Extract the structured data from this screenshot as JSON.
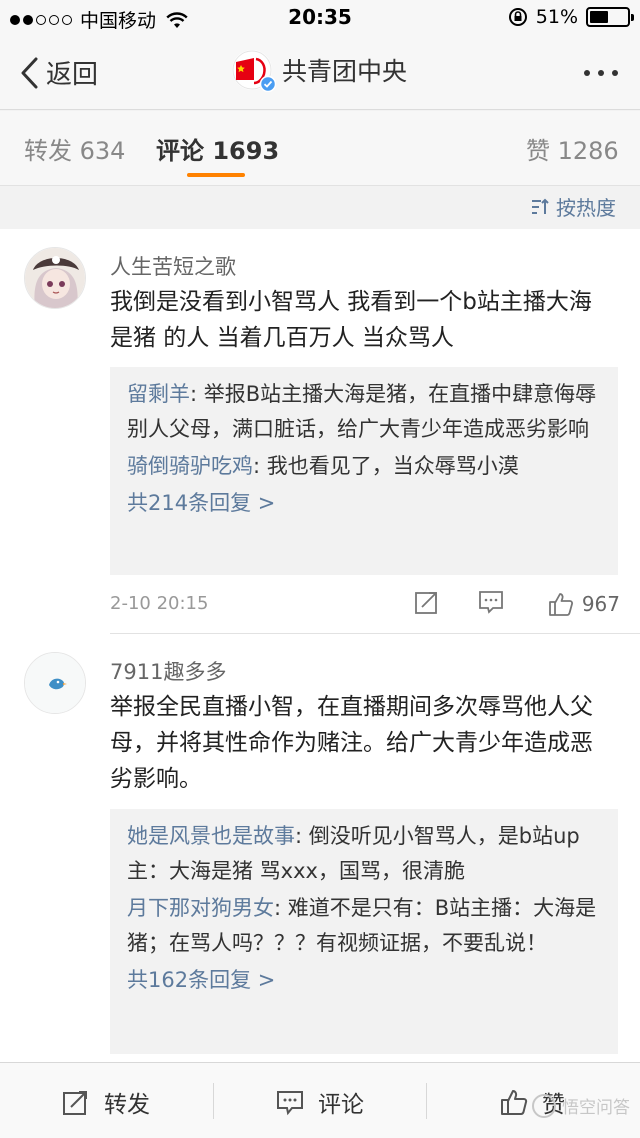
{
  "status_bar": {
    "carrier": "中国移动",
    "time": "20:35",
    "battery_percent": "51%",
    "battery_level": 0.51,
    "signal_bars": 2
  },
  "nav": {
    "back_label": "返回",
    "title": "共青团中央",
    "more_icon": "more-icon"
  },
  "tabs": {
    "repost": "转发 634",
    "comments": "评论 1693",
    "likes": "赞 1286"
  },
  "sort_label": "按热度",
  "comments": [
    {
      "name": "人生苦短之歌",
      "text": "我倒是没看到小智骂人 我看到一个b站主播大海是猪 的人 当着几百万人 当众骂人",
      "replies": [
        {
          "name": "留剩羊",
          "text": ": 举报B站主播大海是猪，在直播中肆意侮辱别人父母，满口脏话，给广大青少年造成恶劣影响"
        },
        {
          "name": "骑倒骑驴吃鸡",
          "text": ": 我也看见了，当众辱骂小漠"
        }
      ],
      "more_replies": "共214条回复 >",
      "time": "2-10 20:15",
      "likes": "967"
    },
    {
      "name": "7911趣多多",
      "text": "举报全民直播小智，在直播期间多次辱骂他人父母，并将其性命作为赌注。给广大青少年造成恶劣影响。",
      "replies": [
        {
          "name": "她是风景也是故事",
          "text": ": 倒没听见小智骂人，是b站up主：大海是猪  骂xxx，国骂，很清脆"
        },
        {
          "name": "月下那对狗男女",
          "text": ": 难道不是只有：B站主播：大海是猪；在骂人吗？？？有视频证据，不要乱说！"
        }
      ],
      "more_replies": "共162条回复 >"
    }
  ],
  "toolbar": {
    "repost": "转发",
    "comment": "评论",
    "like": "赞"
  },
  "watermark": "悟空问答",
  "colors": {
    "accent": "#ff8200",
    "link": "#5d7a9c",
    "reply_bg": "#f2f2f2"
  }
}
